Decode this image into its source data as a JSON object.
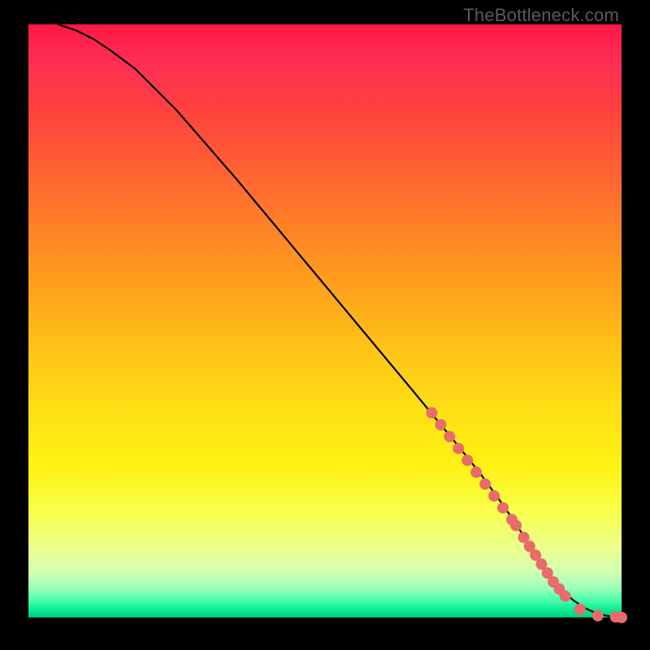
{
  "watermark": "TheBottleneck.com",
  "chart_data": {
    "type": "line",
    "title": "",
    "xlabel": "",
    "ylabel": "",
    "xlim": [
      0,
      100
    ],
    "ylim": [
      0,
      100
    ],
    "grid": false,
    "legend": false,
    "background_gradient": {
      "direction": "vertical",
      "stops": [
        {
          "pos": 0.0,
          "color": "#ff1744"
        },
        {
          "pos": 0.3,
          "color": "#ff7a2a"
        },
        {
          "pos": 0.55,
          "color": "#ffc417"
        },
        {
          "pos": 0.75,
          "color": "#fff314"
        },
        {
          "pos": 0.92,
          "color": "#d5ffb0"
        },
        {
          "pos": 1.0,
          "color": "#00c97a"
        }
      ]
    },
    "series": [
      {
        "name": "curve",
        "color": "#000000",
        "x": [
          5,
          8,
          11,
          14,
          18,
          25,
          35,
          45,
          55,
          65,
          72,
          76,
          80,
          83,
          86,
          88,
          90,
          92,
          94,
          96,
          98,
          100
        ],
        "y": [
          100,
          99,
          97.5,
          95.5,
          92.5,
          85.5,
          74,
          62,
          50,
          38,
          29.5,
          24.5,
          19,
          14.5,
          10,
          7,
          4.5,
          2.8,
          1.5,
          0.6,
          0.2,
          0.0
        ]
      }
    ],
    "markers": {
      "name": "highlighted-points",
      "color": "#e96b6b",
      "radius_px": 7,
      "points": [
        {
          "x": 68,
          "y": 34.5
        },
        {
          "x": 69.5,
          "y": 32.5
        },
        {
          "x": 71,
          "y": 30.5
        },
        {
          "x": 72.5,
          "y": 28.5
        },
        {
          "x": 74,
          "y": 26.5
        },
        {
          "x": 75.5,
          "y": 24.5
        },
        {
          "x": 77,
          "y": 22.5
        },
        {
          "x": 78.5,
          "y": 20.5
        },
        {
          "x": 80,
          "y": 18.5
        },
        {
          "x": 81.5,
          "y": 16.5
        },
        {
          "x": 82.2,
          "y": 15.5
        },
        {
          "x": 83.5,
          "y": 13.5
        },
        {
          "x": 84.5,
          "y": 12
        },
        {
          "x": 85.5,
          "y": 10.5
        },
        {
          "x": 86.5,
          "y": 9
        },
        {
          "x": 87.5,
          "y": 7.5
        },
        {
          "x": 88.5,
          "y": 6
        },
        {
          "x": 89.5,
          "y": 4.8
        },
        {
          "x": 90.5,
          "y": 3.6
        },
        {
          "x": 93,
          "y": 1.4
        },
        {
          "x": 96,
          "y": 0.3
        },
        {
          "x": 99,
          "y": 0.1
        },
        {
          "x": 100,
          "y": 0.0
        }
      ]
    }
  }
}
